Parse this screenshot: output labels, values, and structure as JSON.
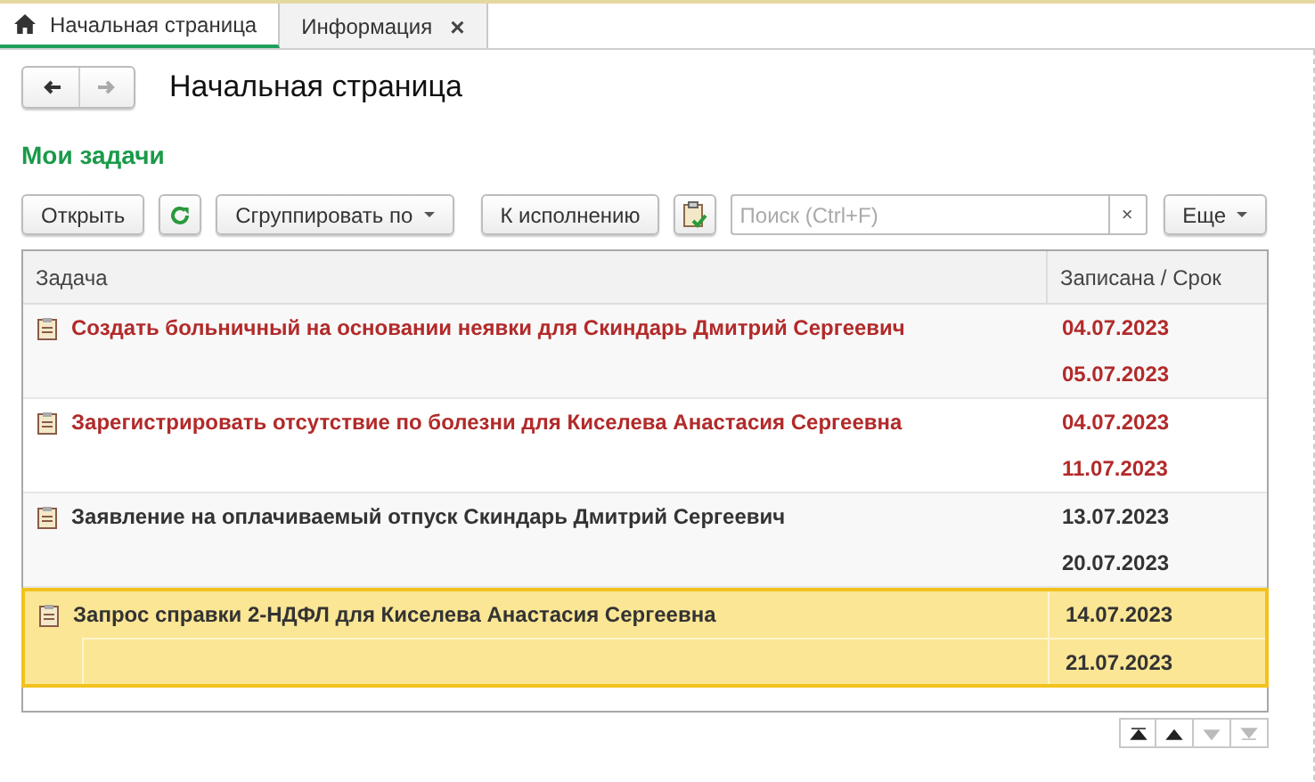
{
  "tabs": [
    {
      "label": "Начальная страница",
      "selected": true,
      "kind": "home"
    },
    {
      "label": "Информация",
      "selected": false,
      "kind": "closable",
      "close": "×"
    }
  ],
  "nav": {
    "back_disabled": false,
    "forward_disabled": true
  },
  "page_title": "Начальная страница",
  "section_title": "Мои задачи",
  "toolbar": {
    "open": "Открыть",
    "group": "Сгруппировать по",
    "execute": "К исполнению",
    "search": {
      "placeholder": "Поиск (Ctrl+F)",
      "clear": "×"
    },
    "more": "Еще"
  },
  "table": {
    "columns": [
      "Задача",
      "Записана / Срок"
    ],
    "rows": [
      {
        "task": "Создать больничный на основании неявки для Скиндарь Дмитрий Сергеевич",
        "recorded": "04.07.2023",
        "due": "05.07.2023",
        "overdue": true,
        "selected": false
      },
      {
        "task": "Зарегистрировать отсутствие по болезни для Киселева Анастасия Сергеевна",
        "recorded": "04.07.2023",
        "due": "11.07.2023",
        "overdue": true,
        "selected": false
      },
      {
        "task": "Заявление на оплачиваемый отпуск Скиндарь Дмитрий Сергеевич",
        "recorded": "13.07.2023",
        "due": "20.07.2023",
        "overdue": false,
        "selected": false
      },
      {
        "task": "Запрос справки 2-НДФЛ для Киселева Анастасия Сергеевна",
        "recorded": "14.07.2023",
        "due": "21.07.2023",
        "overdue": false,
        "selected": true
      }
    ]
  },
  "pager": [
    {
      "kind": "first",
      "disabled": false
    },
    {
      "kind": "up",
      "disabled": false
    },
    {
      "kind": "down",
      "disabled": true
    },
    {
      "kind": "last",
      "disabled": true
    }
  ]
}
